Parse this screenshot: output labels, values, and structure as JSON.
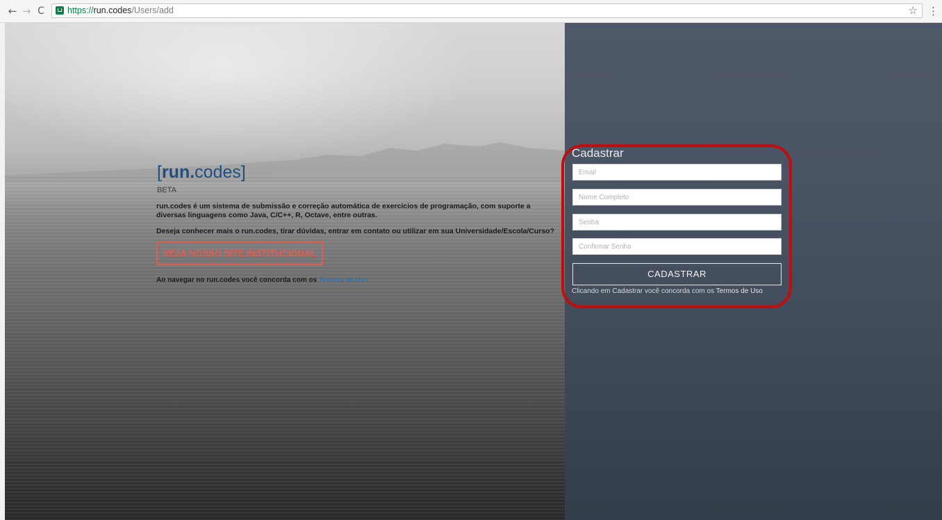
{
  "browser": {
    "url_secure": "https://",
    "url_host": "run.codes",
    "url_path": "/Users/add",
    "back_glyph": "←",
    "forward_glyph": "→",
    "reload_glyph": "C",
    "star_glyph": "☆",
    "menu_glyph": "⋮"
  },
  "hero": {
    "logo_open": "[",
    "logo_bold": "run.",
    "logo_rest": "codes",
    "logo_close": "]",
    "badge": "BETA",
    "description": "run.codes é um sistema de submissão e correção automática de exercícios de programação, com suporte a diversas linguagens como Java, C/C++, R, Octave, entre outras.",
    "question": "Deseja conhecer mais o run.codes, tirar dúvidas, entrar em contato ou utilizar em sua Universidade/Escola/Curso?",
    "institutional_button": "VEJA NOSSO SITE INSTITUCIONAL",
    "terms_prefix": "Ao navegar no run.codes você concorda com os ",
    "terms_link": "Termos de Uso",
    "accent_color": "#e05c4f",
    "link_color": "#2a73b8"
  },
  "register_form": {
    "title": "Cadastrar",
    "email_placeholder": "Email",
    "name_placeholder": "Nome Completo",
    "password_placeholder": "Senha",
    "confirm_placeholder": "Confirmar Senha",
    "submit_label": "CADASTRAR",
    "agree_prefix": "Clicando em Cadastrar você concorda com os ",
    "agree_link": "Termos de Uso",
    "panel_color": "#4a5464",
    "highlight_color": "#c10d0d"
  }
}
